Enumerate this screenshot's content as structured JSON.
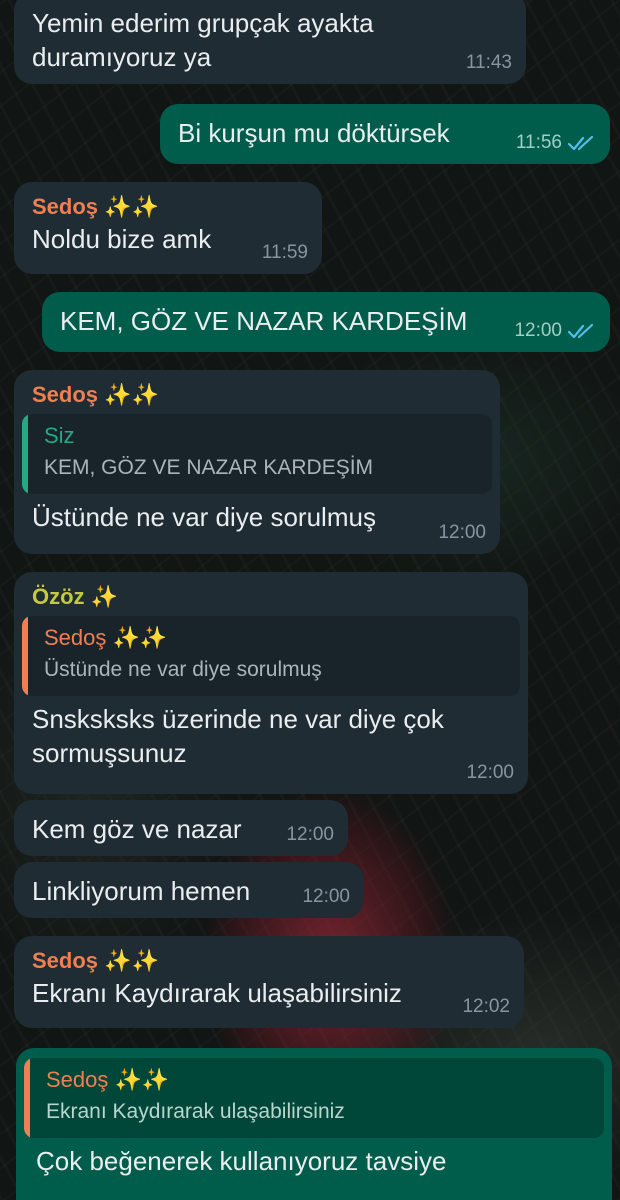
{
  "colors": {
    "incoming_bubble": "#1f2c34",
    "outgoing_bubble": "#005c4b",
    "sender_sedos": "#f07f51",
    "sender_ozoz": "#c5ca3c",
    "sender_siz": "#25a884",
    "read_ticks": "#53bdeb",
    "sparkles": "#f2d54a"
  },
  "icons": {
    "read_status": "double-check-icon",
    "sparkles": "sparkles-emoji"
  },
  "messages": [
    {
      "direction": "in",
      "sender": "",
      "text": "Yemin ederim grupçak ayakta duramıyoruz ya",
      "time": "11:43"
    },
    {
      "direction": "out",
      "text": "Bi kurşun mu döktürsek",
      "time": "11:56",
      "status": "read"
    },
    {
      "direction": "in",
      "sender": "Sedoş ✨✨",
      "text": "Noldu bize amk",
      "time": "11:59"
    },
    {
      "direction": "out",
      "text": "KEM, GÖZ VE NAZAR KARDEŞİM",
      "time": "12:00",
      "status": "read"
    },
    {
      "direction": "in",
      "sender": "Sedoş ✨✨",
      "quote": {
        "name": "Siz",
        "text": "KEM, GÖZ VE NAZAR KARDEŞİM"
      },
      "text": "Üstünde ne var diye sorulmuş",
      "time": "12:00"
    },
    {
      "direction": "in",
      "sender": "Özöz ✨",
      "quote": {
        "name": "Sedoş ✨✨",
        "text": "Üstünde ne var diye sorulmuş"
      },
      "text": "Snsksksks üzerinde ne var diye çok sormuşsunuz",
      "time": "12:00"
    },
    {
      "direction": "in",
      "sender": "",
      "text": "Kem göz ve nazar",
      "time": "12:00"
    },
    {
      "direction": "in",
      "sender": "",
      "text": "Linkliyorum hemen",
      "time": "12:00"
    },
    {
      "direction": "in",
      "sender": "Sedoş ✨✨",
      "text": "Ekranı Kaydırarak ulaşabilirsiniz",
      "time": "12:02"
    },
    {
      "direction": "out",
      "quote": {
        "name": "Sedoş ✨✨",
        "text": "Ekranı Kaydırarak ulaşabilirsiniz"
      },
      "text": "Çok beğenerek kullanıyoruz tavsiye",
      "time": "",
      "status": ""
    }
  ]
}
